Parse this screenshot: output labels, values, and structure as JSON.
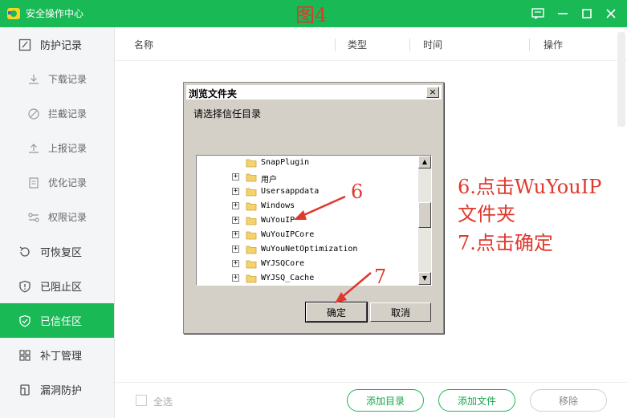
{
  "window": {
    "title": "安全操作中心",
    "figure_label": "图4",
    "logo_icon": "shield-logo-icon",
    "accent_color": "#19b955"
  },
  "sidebar": {
    "items": [
      {
        "label": "防护记录",
        "icon": "edit-icon",
        "level": "top"
      },
      {
        "label": "下载记录",
        "icon": "download-icon",
        "level": "sub"
      },
      {
        "label": "拦截记录",
        "icon": "block-icon",
        "level": "sub"
      },
      {
        "label": "上报记录",
        "icon": "upload-icon",
        "level": "sub"
      },
      {
        "label": "优化记录",
        "icon": "clipboard-icon",
        "level": "sub"
      },
      {
        "label": "权限记录",
        "icon": "key-icon",
        "level": "sub"
      },
      {
        "label": "可恢复区",
        "icon": "restore-icon",
        "level": "top"
      },
      {
        "label": "已阻止区",
        "icon": "shield-alert-icon",
        "level": "top"
      },
      {
        "label": "已信任区",
        "icon": "shield-check-icon",
        "level": "top",
        "active": true
      },
      {
        "label": "补丁管理",
        "icon": "grid-icon",
        "level": "top"
      },
      {
        "label": "漏洞防护",
        "icon": "bug-icon",
        "level": "top"
      }
    ]
  },
  "table": {
    "columns": [
      "名称",
      "类型",
      "时间",
      "操作"
    ]
  },
  "footer": {
    "select_all": "全选",
    "add_dir": "添加目录",
    "add_file": "添加文件",
    "remove": "移除"
  },
  "dialog": {
    "title": "浏览文件夹",
    "close": "×",
    "prompt": "请选择信任目录",
    "tree": [
      {
        "name": "SnapPlugin",
        "expander": false
      },
      {
        "name": "用户",
        "expander": true
      },
      {
        "name": "Usersappdata",
        "expander": true
      },
      {
        "name": "Windows",
        "expander": true
      },
      {
        "name": "WuYouIP",
        "expander": true
      },
      {
        "name": "WuYouIPCore",
        "expander": true
      },
      {
        "name": "WuYouNetOptimization",
        "expander": true
      },
      {
        "name": "WYJSQCore",
        "expander": true
      },
      {
        "name": "WYJSQ_Cache",
        "expander": true
      }
    ],
    "expander_symbol": "+",
    "ok": "确定",
    "cancel": "取消"
  },
  "annotations": {
    "step6_marker": "6",
    "step7_marker": "7",
    "instruction_line1": "6.点击WuYouIP",
    "instruction_line2": "文件夹",
    "instruction_line3": "7.点击确定",
    "color": "#e0382c"
  }
}
